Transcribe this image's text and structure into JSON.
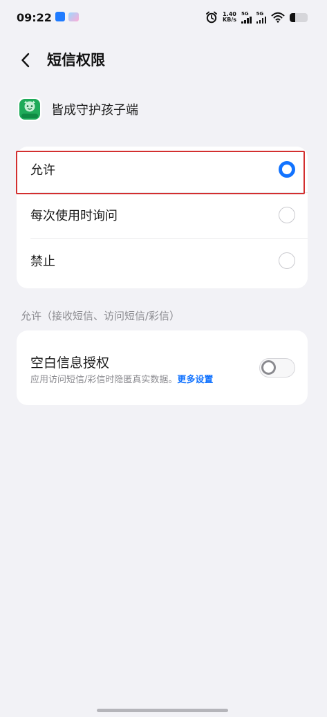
{
  "status_bar": {
    "time": "09:22",
    "net_speed_value": "1.40",
    "net_speed_unit": "KB/s",
    "sim1_network": "5G",
    "sim2_network": "5G",
    "battery_level": 0.32
  },
  "header": {
    "title": "短信权限"
  },
  "app": {
    "name": "皆成守护孩子端",
    "icon_badge": "皆成孩子",
    "icon_color": "#1faa59"
  },
  "options": [
    {
      "label": "允许",
      "selected": true
    },
    {
      "label": "每次使用时询问",
      "selected": false
    },
    {
      "label": "禁止",
      "selected": false
    }
  ],
  "section_caption": "允许（接收短信、访问短信/彩信）",
  "blank_info": {
    "title": "空白信息授权",
    "description": "应用访问短信/彩信时隐匿真实数据。",
    "link_text": "更多设置",
    "enabled": false
  },
  "colors": {
    "accent": "#1273ff",
    "highlight_box": "#d32f2f",
    "background": "#f2f2f6"
  }
}
